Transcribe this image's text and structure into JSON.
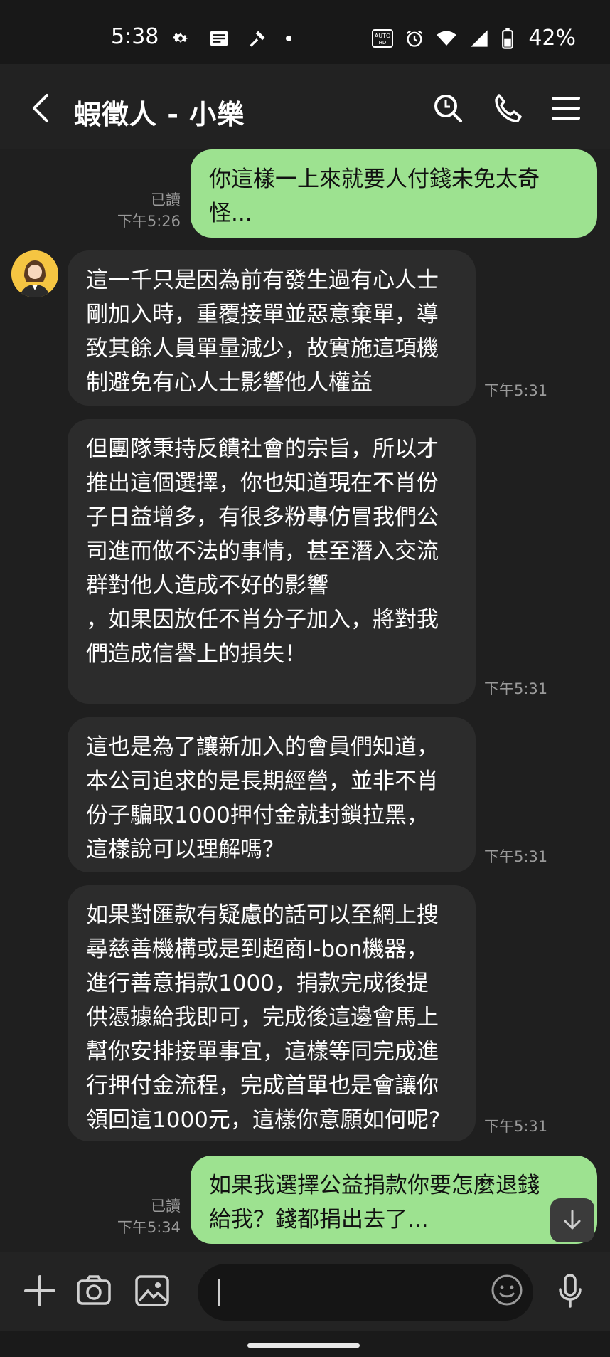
{
  "status_bar": {
    "time": "5:38",
    "icons": [
      "gear-icon",
      "news-icon",
      "tools-icon",
      "dot-icon",
      "auto-hd-icon",
      "alarm-icon",
      "wifi-icon",
      "signal-icon",
      "battery-icon"
    ],
    "battery": "42%"
  },
  "header": {
    "title": "蝦徵人 - 小樂",
    "icons": [
      "back-arrow-icon",
      "search-icon",
      "phone-icon",
      "menu-icon"
    ]
  },
  "messages": [
    {
      "dir": "out",
      "text": "你這樣一上來就要人付錢未免太奇\n怪...",
      "read": "已讀",
      "time": "下午5:26"
    },
    {
      "dir": "in",
      "text": "這一千只是因為前有發生過有心人士\n剛加入時，重覆接單並惡意棄單，導\n致其餘人員單量減少，故實施這項機\n制避免有心人士影響他人權益",
      "time": "下午5:31"
    },
    {
      "dir": "in",
      "text": "但團隊秉持反饋社會的宗旨，所以才\n推出這個選擇，你也知道現在不肖份\n子日益增多，有很多粉專仿冒我們公\n司進而做不法的事情，甚至潛入交流\n群對他人造成不好的影響\n，如果因放任不肖分子加入，將對我\n們造成信譽上的損失！\n",
      "time": "下午5:31"
    },
    {
      "dir": "in",
      "text": "這也是為了讓新加入的會員們知道，\n本公司追求的是長期經營，並非不肖\n份子騙取1000押付金就封鎖拉黑，\n這樣說可以理解嗎？",
      "time": "下午5:31"
    },
    {
      "dir": "in",
      "text": "如果對匯款有疑慮的話可以至網上搜\n尋慈善機構或是到超商I-bon機器，\n進行善意捐款1000，捐款完成後提\n供憑據給我即可，完成後這邊會馬上\n幫你安排接單事宜，這樣等同完成進\n行押付金流程，完成首單也是會讓你\n領回這1000元，這樣你意願如何呢?",
      "time": "下午5:31"
    },
    {
      "dir": "out",
      "text": "如果我選擇公益捐款你要怎麼退錢\n給我？錢都捐出去了...",
      "read": "已讀",
      "time": "下午5:34"
    }
  ],
  "composer": {
    "value": "",
    "icons": [
      "plus-icon",
      "camera-icon",
      "image-icon",
      "emoji-icon",
      "microphone-icon"
    ]
  },
  "colors": {
    "background": "#1f1f1f",
    "incoming_bubble": "#2c2c2c",
    "outgoing_bubble": "#9de290"
  }
}
